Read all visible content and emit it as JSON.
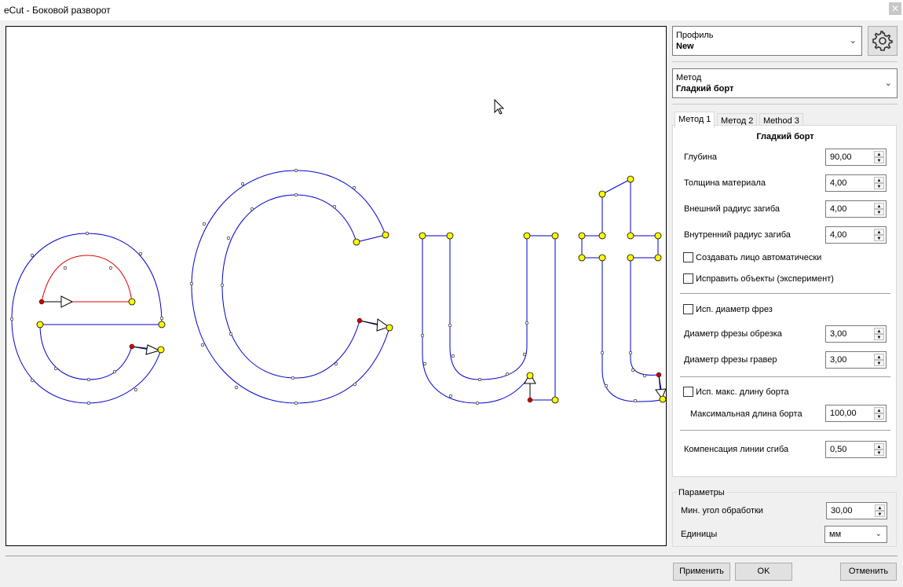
{
  "window": {
    "title": "eCut - Боковой разворот",
    "close_glyph": "✕"
  },
  "profile": {
    "label": "Профиль",
    "value": "New"
  },
  "method": {
    "label": "Метод",
    "value": "Гладкий борт"
  },
  "tabs": [
    {
      "label": "Метод 1",
      "active": true
    },
    {
      "label": "Метод 2",
      "active": false
    },
    {
      "label": "Method 3",
      "active": false
    }
  ],
  "pane": {
    "title": "Гладкий борт",
    "depth": {
      "label": "Глубина",
      "value": "90,00"
    },
    "thickness": {
      "label": "Толщина материала",
      "value": "4,00"
    },
    "outer_radius": {
      "label": "Внешний радиус загиба",
      "value": "4,00"
    },
    "inner_radius": {
      "label": "Внутренний радиус загиба",
      "value": "4,00"
    },
    "auto_face": {
      "label": "Создавать лицо автоматически",
      "checked": false
    },
    "fix_objects": {
      "label": "Исправить объекты (эксперимент)",
      "checked": false
    },
    "use_cutter": {
      "label": "Исп. диаметр фрез",
      "checked": false
    },
    "trim_cutter": {
      "label": "Диаметр фрезы обрезка",
      "value": "3,00"
    },
    "engrave_cutter": {
      "label": "Диаметр фрезы гравер",
      "value": "3,00"
    },
    "use_max_len": {
      "label": "Исп. макс. длину борта",
      "checked": false
    },
    "max_len": {
      "label": "Максимальная длина борта",
      "value": "100,00"
    },
    "fold_comp": {
      "label": "Компенсация линии сгиба",
      "value": "0,50"
    }
  },
  "params": {
    "title": "Параметры",
    "min_angle": {
      "label": "Мин. угол обработки",
      "value": "30,00"
    },
    "units": {
      "label": "Единицы",
      "value": "мм"
    }
  },
  "buttons": {
    "apply": "Применить",
    "ok": "OK",
    "cancel": "Отменить"
  },
  "icons": {
    "gear": "gear-icon",
    "cursor": "mouse-cursor-icon"
  },
  "colors": {
    "outline": "#0000cc",
    "highlight": "#dd0000",
    "node": "#ffff00",
    "start_node": "#cc0000"
  }
}
